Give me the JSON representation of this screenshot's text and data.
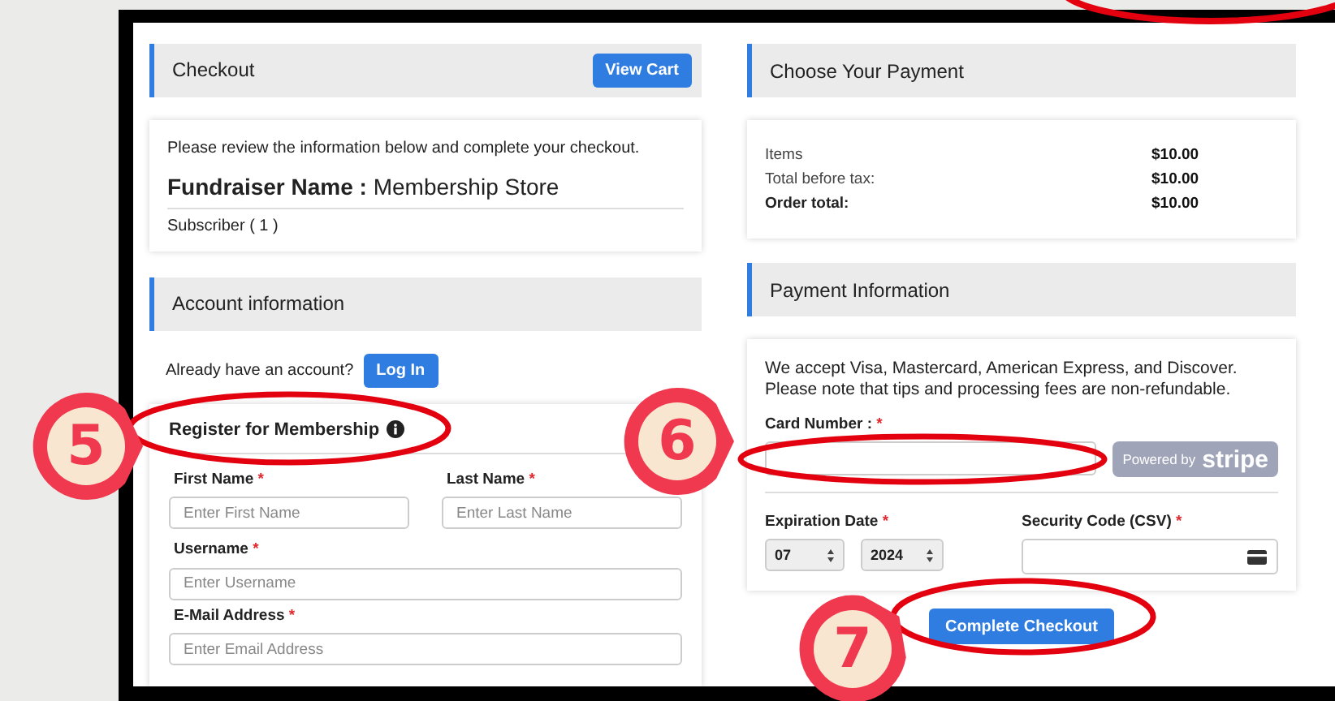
{
  "annotations": [
    {
      "number": "5"
    },
    {
      "number": "6"
    },
    {
      "number": "7"
    }
  ],
  "checkout": {
    "title": "Checkout",
    "button": "View Cart",
    "intro": "Please review the information below and complete your checkout.",
    "fundraiser_label": "Fundraiser Name :",
    "fundraiser_value": "Membership Store",
    "item": "Subscriber ( 1 )"
  },
  "account": {
    "title": "Account information",
    "prompt": "Already have an account?",
    "login": "Log In",
    "register_title": "Register for Membership",
    "fields": [
      {
        "label": "First Name",
        "required": true,
        "required_mark": "*",
        "placeholder": "Enter First Name"
      },
      {
        "label": "Last Name",
        "required": true,
        "required_mark": "*",
        "placeholder": "Enter Last Name"
      },
      {
        "label": "Username",
        "required": true,
        "required_mark": "*",
        "placeholder": "Enter Username"
      },
      {
        "label": "E-Mail Address",
        "required": true,
        "required_mark": "*",
        "placeholder": "Enter Email Address"
      }
    ]
  },
  "payment": {
    "title": "Choose Your Payment",
    "summary": [
      {
        "label": "Items",
        "value": "$10.00",
        "bold": false
      },
      {
        "label": "Total before tax:",
        "value": "$10.00",
        "bold": false
      },
      {
        "label": "Order total:",
        "value": "$10.00",
        "bold": true
      }
    ]
  },
  "payment_info": {
    "title": "Payment Information",
    "note": "We accept Visa, Mastercard, American Express, and Discover. Please note that tips and processing fees are non-refundable.",
    "card_label": "Card Number :",
    "card_required": true,
    "card_required_mark": "*",
    "stripe_prefix": "Powered by",
    "stripe_brand": "stripe",
    "expiry_label": "Expiration Date",
    "expiry_required": true,
    "expiry_required_mark": "*",
    "month": "07",
    "year": "2024",
    "csv_label": "Security Code (CSV)",
    "csv_required": true,
    "csv_required_mark": "*",
    "submit": "Complete Checkout"
  }
}
